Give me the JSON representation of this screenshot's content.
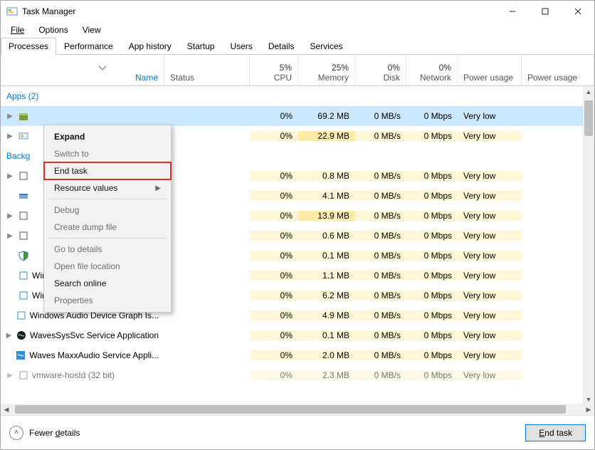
{
  "window": {
    "title": "Task Manager"
  },
  "menu": {
    "file": "File",
    "options": "Options",
    "view": "View"
  },
  "tabs": [
    "Processes",
    "Performance",
    "App history",
    "Startup",
    "Users",
    "Details",
    "Services"
  ],
  "headers": {
    "name": "Name",
    "status": "Status",
    "cpu_top": "5%",
    "cpu": "CPU",
    "mem_top": "25%",
    "mem": "Memory",
    "disk_top": "0%",
    "disk": "Disk",
    "net_top": "0%",
    "net": "Network",
    "power": "Power usage",
    "power2": "Power usage"
  },
  "groups": {
    "apps": "Apps (2)",
    "bg": "Backg"
  },
  "rows": [
    {
      "name": "",
      "cpu": "0%",
      "mem": "69.2 MB",
      "disk": "0 MB/s",
      "net": "0 Mbps",
      "power": "Very low"
    },
    {
      "name": "",
      "cpu": "0%",
      "mem": "22.9 MB",
      "disk": "0 MB/s",
      "net": "0 Mbps",
      "power": "Very low"
    },
    {
      "name": "",
      "cpu": "0%",
      "mem": "0.8 MB",
      "disk": "0 MB/s",
      "net": "0 Mbps",
      "power": "Very low"
    },
    {
      "name": "",
      "cpu": "0%",
      "mem": "4.1 MB",
      "disk": "0 MB/s",
      "net": "0 Mbps",
      "power": "Very low"
    },
    {
      "name": "",
      "cpu": "0%",
      "mem": "13.9 MB",
      "disk": "0 MB/s",
      "net": "0 Mbps",
      "power": "Very low"
    },
    {
      "name": "",
      "cpu": "0%",
      "mem": "0.6 MB",
      "disk": "0 MB/s",
      "net": "0 Mbps",
      "power": "Very low"
    },
    {
      "name": "",
      "cpu": "0%",
      "mem": "0.1 MB",
      "disk": "0 MB/s",
      "net": "0 Mbps",
      "power": "Very low"
    },
    {
      "name": "Windows Security Health Service",
      "cpu": "0%",
      "mem": "1.1 MB",
      "disk": "0 MB/s",
      "net": "0 Mbps",
      "power": "Very low"
    },
    {
      "name": "Windows Defender SmartScreen",
      "cpu": "0%",
      "mem": "6.2 MB",
      "disk": "0 MB/s",
      "net": "0 Mbps",
      "power": "Very low"
    },
    {
      "name": "Windows Audio Device Graph Is...",
      "cpu": "0%",
      "mem": "4.9 MB",
      "disk": "0 MB/s",
      "net": "0 Mbps",
      "power": "Very low"
    },
    {
      "name": "WavesSysSvc Service Application",
      "cpu": "0%",
      "mem": "0.1 MB",
      "disk": "0 MB/s",
      "net": "0 Mbps",
      "power": "Very low"
    },
    {
      "name": "Waves MaxxAudio Service Appli...",
      "cpu": "0%",
      "mem": "2.0 MB",
      "disk": "0 MB/s",
      "net": "0 Mbps",
      "power": "Very low"
    },
    {
      "name": "vmware-hostd (32 bit)",
      "cpu": "0%",
      "mem": "2.3 MB",
      "disk": "0 MB/s",
      "net": "0 Mbps",
      "power": "Very low"
    }
  ],
  "context_menu": {
    "expand": "Expand",
    "switch_to": "Switch to",
    "end_task": "End task",
    "resource_values": "Resource values",
    "debug": "Debug",
    "create_dump": "Create dump file",
    "go_details": "Go to details",
    "open_loc": "Open file location",
    "search_online": "Search online",
    "properties": "Properties"
  },
  "footer": {
    "fewer": "Fewer details",
    "end_task": "End task"
  }
}
